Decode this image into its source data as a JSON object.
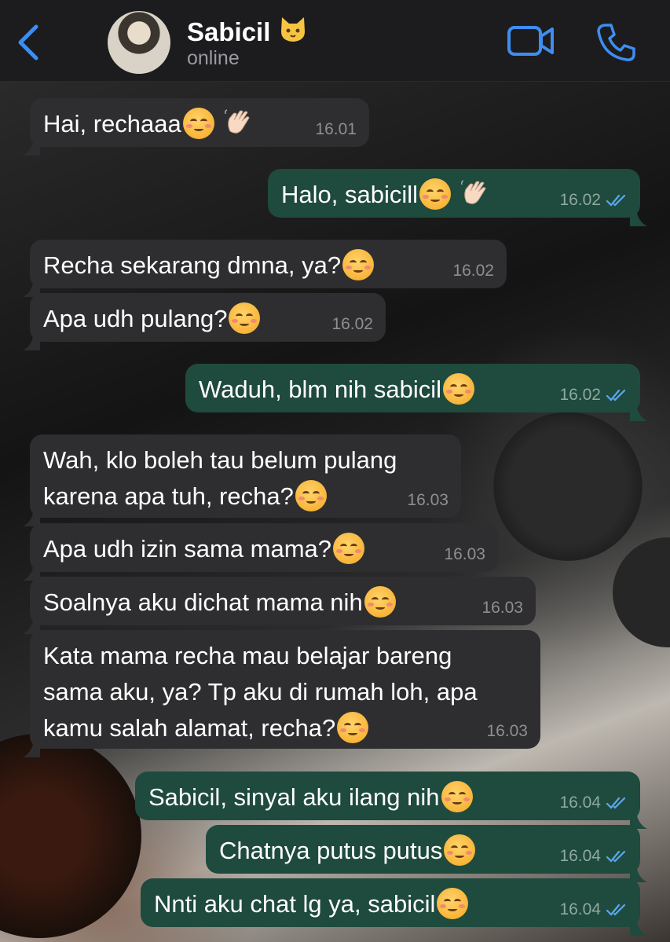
{
  "header": {
    "contact_name": "Sabicil",
    "name_emoji": "cat-face-emoji",
    "status": "online",
    "back_icon": "chevron-left-icon",
    "video_icon": "video-camera-icon",
    "call_icon": "phone-icon",
    "accent_color": "#3d8ef0"
  },
  "messages": [
    {
      "dir": "in",
      "text": "Hai, rechaaa",
      "emoji": [
        "smiling-face-emoji",
        "waving-hand-emoji"
      ],
      "time": "16.01"
    },
    {
      "dir": "out",
      "text": "Halo, sabicill",
      "emoji": [
        "smiling-face-emoji",
        "waving-hand-emoji"
      ],
      "time": "16.02"
    },
    {
      "dir": "in",
      "text": "Recha sekarang dmna, ya?",
      "emoji": [
        "smiling-face-emoji"
      ],
      "time": "16.02"
    },
    {
      "dir": "in",
      "text": "Apa udh pulang?",
      "emoji": [
        "smiling-face-emoji"
      ],
      "time": "16.02"
    },
    {
      "dir": "out",
      "text": "Waduh, blm nih sabicil",
      "emoji": [
        "smiling-face-emoji"
      ],
      "time": "16.02"
    },
    {
      "dir": "in",
      "text": "Wah, klo boleh tau belum pulang",
      "text2": "karena apa tuh, recha?",
      "emoji": [
        "smiling-face-emoji"
      ],
      "time": "16.03"
    },
    {
      "dir": "in",
      "text": "Apa udh izin sama mama?",
      "emoji": [
        "smiling-face-emoji"
      ],
      "time": "16.03"
    },
    {
      "dir": "in",
      "text": "Soalnya aku dichat mama nih",
      "emoji": [
        "smiling-face-emoji"
      ],
      "time": "16.03"
    },
    {
      "dir": "in",
      "text": "Kata mama recha mau belajar bareng",
      "text2": "sama aku, ya? Tp aku di rumah loh, apa",
      "text3": "kamu salah alamat, recha?",
      "emoji": [
        "smiling-face-emoji"
      ],
      "time": "16.03"
    },
    {
      "dir": "out",
      "text": "Sabicil, sinyal aku ilang nih",
      "emoji": [
        "smiling-face-emoji"
      ],
      "time": "16.04"
    },
    {
      "dir": "out",
      "text": "Chatnya putus putus",
      "emoji": [
        "smiling-face-emoji"
      ],
      "time": "16.04"
    },
    {
      "dir": "out",
      "text": "Nnti aku chat lg ya, sabicil",
      "emoji": [
        "smiling-face-emoji"
      ],
      "time": "16.04"
    }
  ],
  "read_receipt_icon": "double-check-icon",
  "colors": {
    "incoming_bubble": "#2e2e30",
    "outgoing_bubble": "#1f4a3e",
    "read_receipt": "#5aa7f2"
  }
}
